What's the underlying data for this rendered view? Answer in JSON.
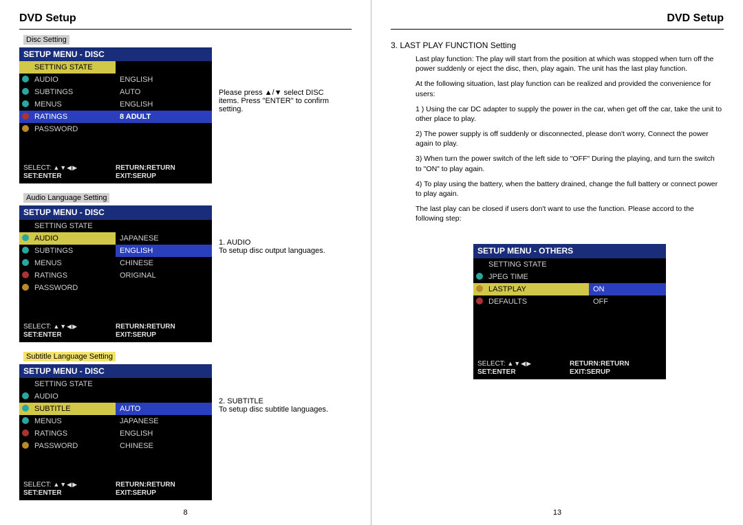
{
  "left": {
    "title": "DVD Setup",
    "section1_label": "Disc Setting",
    "menu1": {
      "header": "SETUP MENU - DISC",
      "items": [
        "SETTING STATE",
        "AUDIO",
        "SUBTINGS",
        "MENUS",
        "RATINGS",
        "PASSWORD"
      ],
      "values": [
        "ENGLISH",
        "AUTO",
        "ENGLISH",
        "8  ADULT"
      ],
      "footer": {
        "select": "SELECT:",
        "arrows": "▲▼◀▶",
        "set": "SET:ENTER",
        "ret": "RETURN:RETURN",
        "exit": "EXIT:SERUP"
      }
    },
    "caption1": "Please press ▲/▼ select DISC items. Press \"ENTER\" to confirm setting.",
    "section2_label": "Audio Language Setting",
    "menu2": {
      "header": "SETUP MENU - DISC",
      "items": [
        "SETTING STATE",
        "AUDIO",
        "SUBTINGS",
        "MENUS",
        "RATINGS",
        "PASSWORD"
      ],
      "values": [
        "JAPANESE",
        "ENGLISH",
        "CHINESE",
        "ORIGINAL"
      ]
    },
    "caption2a": "1. AUDIO",
    "caption2b": "To setup disc output languages.",
    "section3_label": "Subtitle Language Setting",
    "menu3": {
      "header": "SETUP MENU - DISC",
      "items": [
        "SETTING STATE",
        "AUDIO",
        "SUBTITLE",
        "MENUS",
        "RATINGS",
        "PASSWORD"
      ],
      "values": [
        "AUTO",
        "JAPANESE",
        "ENGLISH",
        "CHINESE"
      ]
    },
    "caption3a": "2. SUBTITLE",
    "caption3b": "To setup disc subtitle languages.",
    "pagenum": "8"
  },
  "right": {
    "title": "DVD Setup",
    "heading": "3. LAST PLAY FUNCTION Setting",
    "p1": "Last play function: The play will start from the position at which was stopped when turn off the power suddenly or eject the disc, then, play again. The unit has the last play function.",
    "p2": "At the following situation, last play function can be realized and provided the convenience for users:",
    "p3": "1 ) Using the car DC adapter to supply the power in the car, when get off the car, take the unit to other place to play.",
    "p4": "2) The power supply is off suddenly or disconnected, please don't worry, Connect the power again to play.",
    "p5": "3) When turn the power switch of the left side to \"OFF\" During the playing, and turn the switch to \"ON\" to play again.",
    "p6": "4) To play using the battery, when the battery drained, change the full battery or connect power to play again.",
    "p7": "The last play can be closed if users don't want to use the function. Please accord to the following step:",
    "menu": {
      "header": "SETUP MENU - OTHERS",
      "items": [
        "SETTING STATE",
        "JPEG TIME",
        "LASTPLAY",
        "DEFAULTS"
      ],
      "values": [
        "ON",
        "OFF"
      ],
      "footer": {
        "select": "SELECT:",
        "arrows": "▲▼◀▶",
        "set": "SET:ENTER",
        "ret": "RETURN:RETURN",
        "exit": "EXIT:SERUP"
      }
    },
    "pagenum": "13"
  }
}
